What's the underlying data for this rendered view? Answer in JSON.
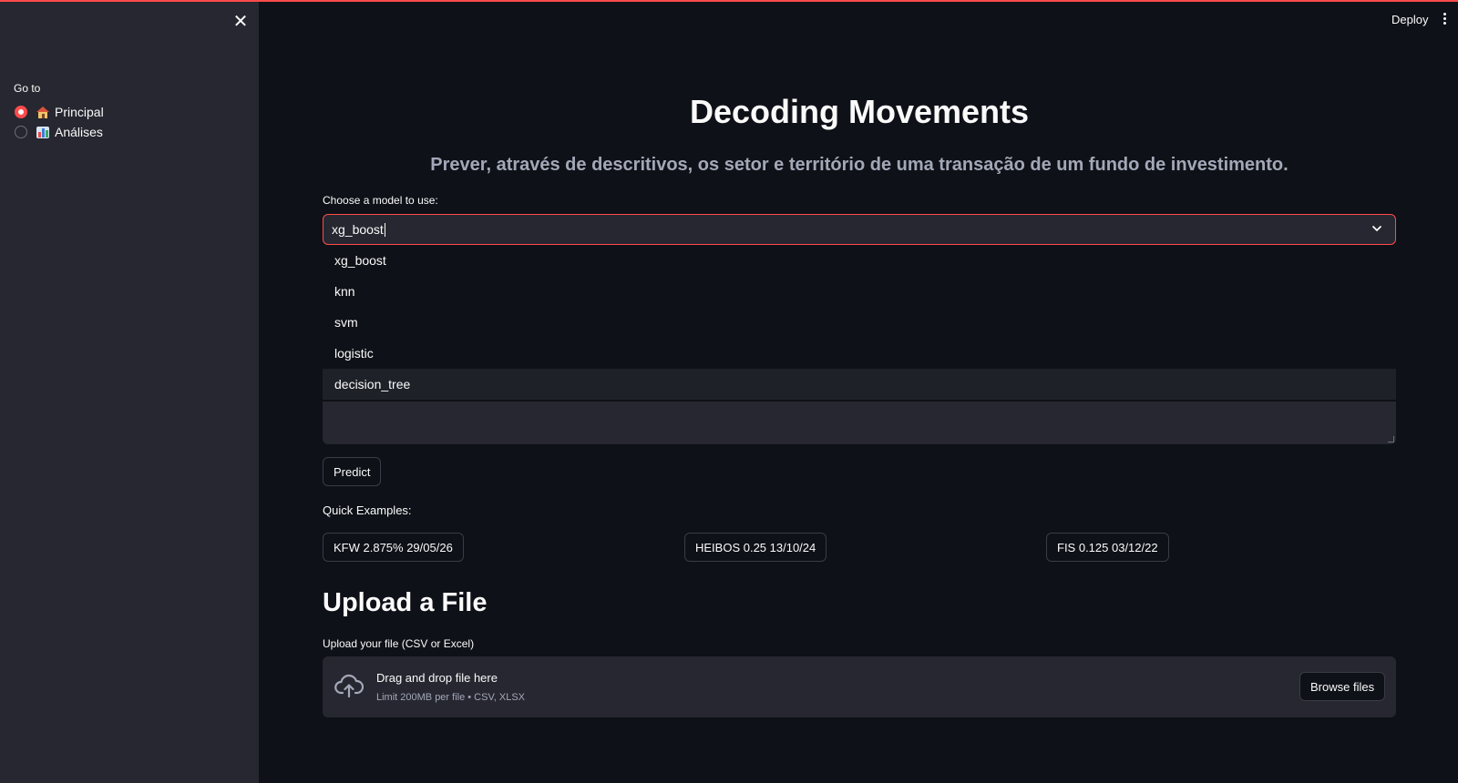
{
  "app": {
    "deploy_label": "Deploy",
    "accent_color": "#ff4b4b"
  },
  "sidebar": {
    "nav_label": "Go to",
    "options": [
      {
        "label": "Principal",
        "icon": "house-icon",
        "selected": true
      },
      {
        "label": "Análises",
        "icon": "bar-chart-icon",
        "selected": false
      }
    ]
  },
  "main": {
    "title": "Decoding Movements",
    "subtitle": "Prever, através de descritivos, os setor e território de uma transação de um fundo de investimento.",
    "model_select": {
      "label": "Choose a model to use:",
      "value": "xg_boost",
      "options": [
        "xg_boost",
        "knn",
        "svm",
        "logistic",
        "decision_tree"
      ],
      "hovered_option": "decision_tree"
    },
    "predict_label": "Predict",
    "quick_examples": {
      "label": "Quick Examples:",
      "items": [
        "KFW 2.875% 29/05/26",
        "HEIBOS 0.25 13/10/24",
        "FIS 0.125 03/12/22"
      ]
    },
    "upload": {
      "title": "Upload a File",
      "label": "Upload your file (CSV or Excel)",
      "drop_title": "Drag and drop file here",
      "drop_subtitle": "Limit 200MB per file • CSV, XLSX",
      "browse_label": "Browse files"
    }
  }
}
